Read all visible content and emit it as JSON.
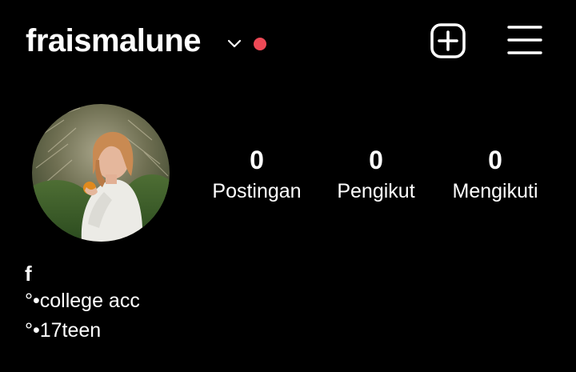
{
  "header": {
    "username": "fraismalune",
    "icons": {
      "chevron": "chevron-down-icon",
      "notification": "notification-dot",
      "add": "plus-square-icon",
      "menu": "hamburger-menu-icon"
    },
    "notification_color": "#ed4956"
  },
  "profile": {
    "avatar": "avatar-photo",
    "stats": {
      "posts": {
        "value": "0",
        "label": "Postingan"
      },
      "followers": {
        "value": "0",
        "label": "Pengikut"
      },
      "following": {
        "value": "0",
        "label": "Mengikuti"
      }
    },
    "display_name": "f",
    "bio": [
      "°•college acc",
      "°•17teen"
    ]
  }
}
